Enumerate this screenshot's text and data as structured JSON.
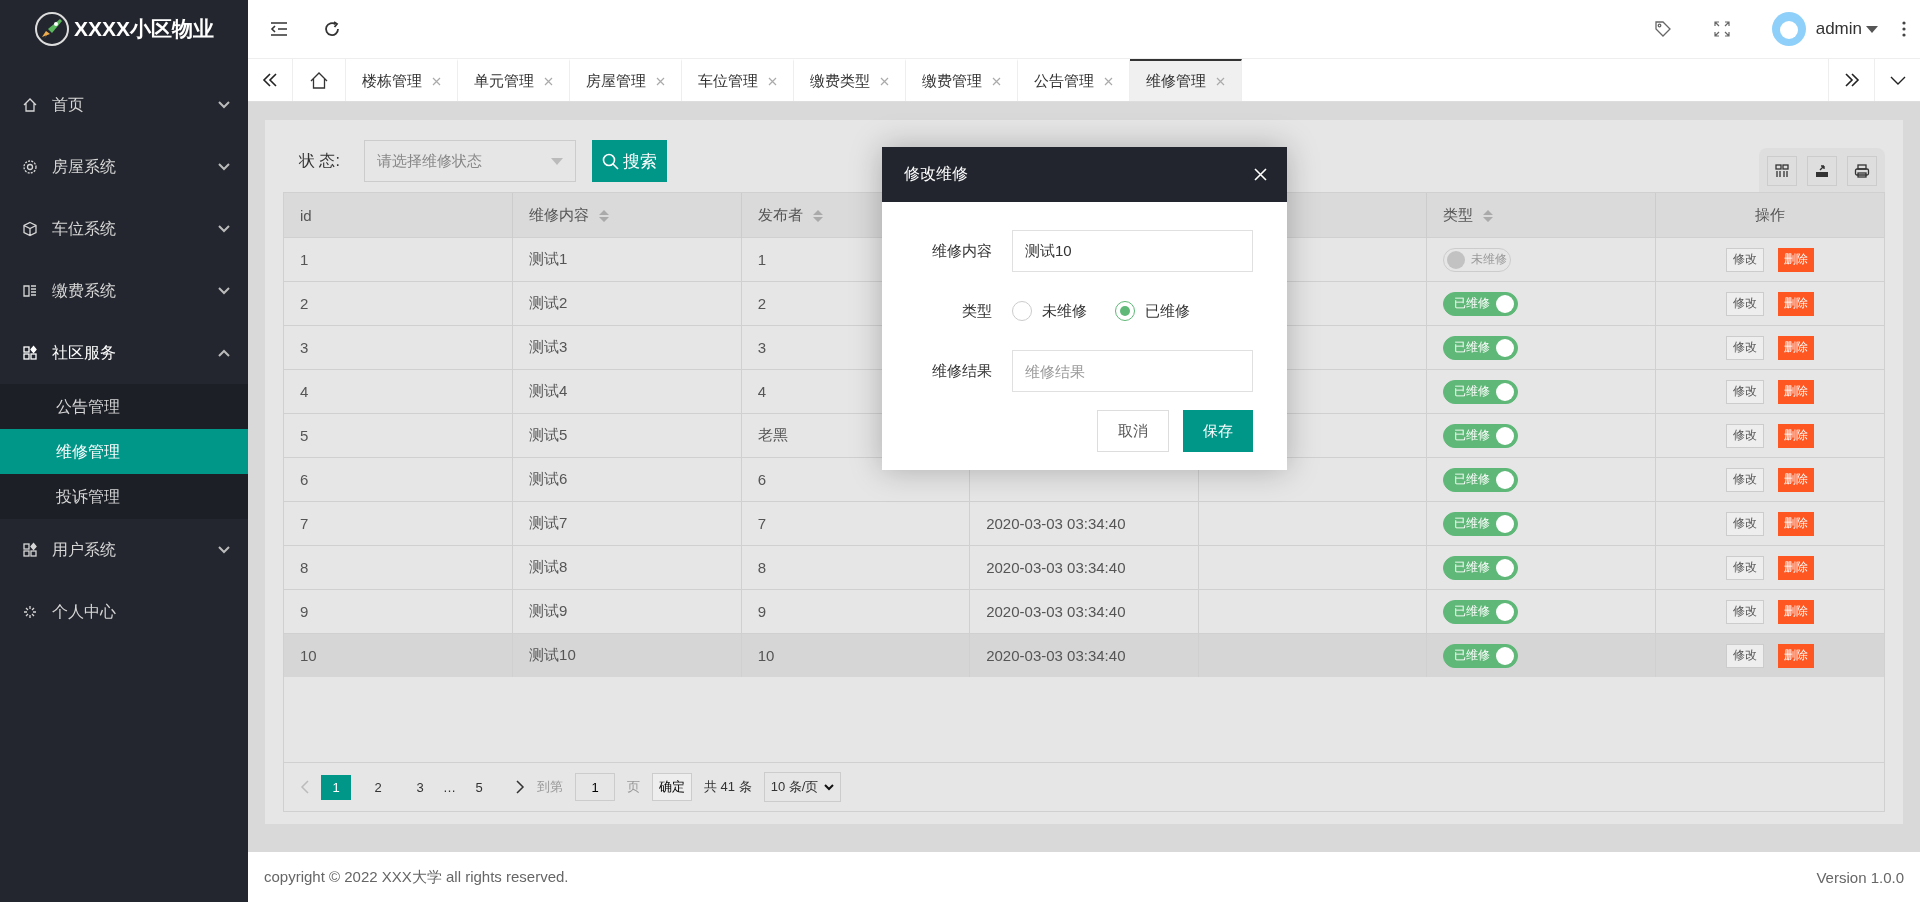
{
  "brand": {
    "title": "XXXX小区物业"
  },
  "sidebar": {
    "items": [
      {
        "label": "首页",
        "expanded": false
      },
      {
        "label": "房屋系统",
        "expanded": false
      },
      {
        "label": "车位系统",
        "expanded": false
      },
      {
        "label": "缴费系统",
        "expanded": false
      },
      {
        "label": "社区服务",
        "expanded": true,
        "children": [
          {
            "label": "公告管理",
            "selected": false
          },
          {
            "label": "维修管理",
            "selected": true
          },
          {
            "label": "投诉管理",
            "selected": false
          }
        ]
      },
      {
        "label": "用户系统",
        "expanded": false
      },
      {
        "label": "个人中心"
      }
    ]
  },
  "header": {
    "user": "admin"
  },
  "tabs": [
    {
      "label": "楼栋管理",
      "selected": false
    },
    {
      "label": "单元管理",
      "selected": false
    },
    {
      "label": "房屋管理",
      "selected": false
    },
    {
      "label": "车位管理",
      "selected": false
    },
    {
      "label": "缴费类型",
      "selected": false
    },
    {
      "label": "缴费管理",
      "selected": false
    },
    {
      "label": "公告管理",
      "selected": false
    },
    {
      "label": "维修管理",
      "selected": true
    }
  ],
  "filter": {
    "label": "状 态:",
    "placeholder": "请选择维修状态",
    "button": "搜索"
  },
  "table": {
    "columns": [
      {
        "label": "id",
        "sortable": false
      },
      {
        "label": "维修内容",
        "sortable": true
      },
      {
        "label": "发布者",
        "sortable": true
      },
      {
        "label": "类型",
        "sortable": true
      },
      {
        "label": "操作",
        "sortable": false
      }
    ],
    "rows": [
      {
        "id": "1",
        "content": "测试1",
        "publisher": "1",
        "repaired": false,
        "status": "未维修",
        "edit": "修改",
        "delete": "删除",
        "selected": false
      },
      {
        "id": "2",
        "content": "测试2",
        "publisher": "2",
        "repaired": true,
        "status": "已维修",
        "edit": "修改",
        "delete": "删除",
        "selected": false
      },
      {
        "id": "3",
        "content": "测试3",
        "publisher": "3",
        "repaired": true,
        "status": "已维修",
        "edit": "修改",
        "delete": "删除",
        "selected": false
      },
      {
        "id": "4",
        "content": "测试4",
        "publisher": "4",
        "repaired": true,
        "status": "已维修",
        "edit": "修改",
        "delete": "删除",
        "selected": false
      },
      {
        "id": "5",
        "content": "测试5",
        "publisher": "老黑",
        "repaired": true,
        "status": "已维修",
        "edit": "修改",
        "delete": "删除",
        "selected": false
      },
      {
        "id": "6",
        "content": "测试6",
        "publisher": "6",
        "repaired": true,
        "status": "已维修",
        "edit": "修改",
        "delete": "删除",
        "selected": false
      },
      {
        "id": "7",
        "content": "测试7",
        "publisher": "7",
        "date": "2020-03-03 03:34:40",
        "repaired": true,
        "status": "已维修",
        "edit": "修改",
        "delete": "删除",
        "selected": false
      },
      {
        "id": "8",
        "content": "测试8",
        "publisher": "8",
        "date": "2020-03-03 03:34:40",
        "repaired": true,
        "status": "已维修",
        "edit": "修改",
        "delete": "删除",
        "selected": false
      },
      {
        "id": "9",
        "content": "测试9",
        "publisher": "9",
        "date": "2020-03-03 03:34:40",
        "repaired": true,
        "status": "已维修",
        "edit": "修改",
        "delete": "删除",
        "selected": false
      },
      {
        "id": "10",
        "content": "测试10",
        "publisher": "10",
        "date": "2020-03-03 03:34:40",
        "repaired": true,
        "status": "已维修",
        "edit": "修改",
        "delete": "删除",
        "selected": true
      }
    ]
  },
  "pagination": {
    "pages": [
      {
        "kind": "page",
        "label": "1",
        "selected": true
      },
      {
        "kind": "page",
        "label": "2",
        "selected": false
      },
      {
        "kind": "page",
        "label": "3",
        "selected": false
      },
      {
        "kind": "ellipsis",
        "label": "…"
      },
      {
        "kind": "page",
        "label": "5",
        "selected": false
      }
    ],
    "goto_label": "到第",
    "page_value": "1",
    "page_unit": "页",
    "confirm": "确定",
    "total": "共 41 条",
    "page_size": "10 条/页"
  },
  "modal": {
    "title": "修改维修",
    "fields": [
      {
        "kind": "text",
        "label": "维修内容",
        "value": "测试10"
      },
      {
        "kind": "radio",
        "label": "类型",
        "options": [
          {
            "label": "未维修",
            "selected": false
          },
          {
            "label": "已维修",
            "selected": true
          }
        ]
      },
      {
        "kind": "text",
        "label": "维修结果",
        "placeholder": "维修结果"
      }
    ],
    "buttons": [
      {
        "kind": "secondary",
        "label": "取消"
      },
      {
        "kind": "primary",
        "label": "保存"
      }
    ]
  },
  "footer": {
    "copyright": "copyright © 2022 XXX大学 all rights reserved.",
    "version": "Version 1.0.0"
  }
}
